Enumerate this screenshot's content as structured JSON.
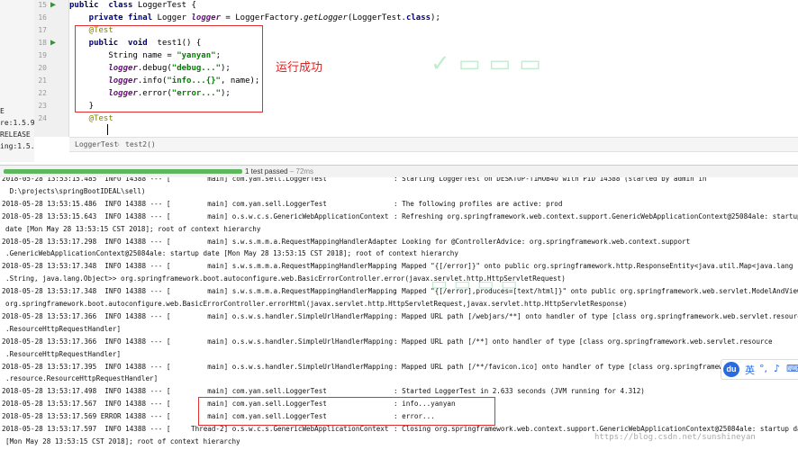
{
  "left_strip": [
    "E",
    "re:1.5.9.RE",
    "RELEASE",
    "ing:1.5.9.R"
  ],
  "editor": {
    "line_numbers": [
      "15",
      "16",
      "17",
      "18",
      "19",
      "20",
      "21",
      "22",
      "23",
      "24"
    ],
    "lines": [
      {
        "n": "15",
        "parts": [
          [
            "kw",
            "public  class "
          ],
          [
            "cls",
            "LoggerTest {"
          ]
        ]
      },
      {
        "n": "16",
        "parts": [
          [
            "kw",
            "    private final "
          ],
          [
            "cls",
            "Logger "
          ],
          [
            "fld",
            "logger"
          ],
          [
            "cls",
            " = LoggerFactory."
          ],
          [
            "it",
            "getLogger"
          ],
          [
            "cls",
            "(LoggerTest."
          ],
          [
            "kw",
            "class"
          ],
          [
            "cls",
            ");"
          ]
        ]
      },
      {
        "n": "17",
        "parts": [
          [
            "ann",
            "    @Test"
          ]
        ]
      },
      {
        "n": "18",
        "parts": [
          [
            "kw",
            "    public  void "
          ],
          [
            "cls",
            " test1() {"
          ]
        ]
      },
      {
        "n": "19",
        "parts": [
          [
            "cls",
            "        String name = "
          ],
          [
            "str",
            "\"yanyan\""
          ],
          [
            "cls",
            ";"
          ]
        ]
      },
      {
        "n": "20",
        "parts": [
          [
            "fld",
            "        logger"
          ],
          [
            "cls",
            ".debug("
          ],
          [
            "str",
            "\"debug...\""
          ],
          [
            "cls",
            ");"
          ]
        ]
      },
      {
        "n": "21",
        "parts": [
          [
            "fld",
            "        logger"
          ],
          [
            "cls",
            ".info("
          ],
          [
            "str",
            "\"info...{}\""
          ],
          [
            "cls",
            ", name);"
          ]
        ]
      },
      {
        "n": "22",
        "parts": [
          [
            "fld",
            "        logger"
          ],
          [
            "cls",
            ".error("
          ],
          [
            "str",
            "\"error...\""
          ],
          [
            "cls",
            ");"
          ]
        ]
      },
      {
        "n": "23",
        "parts": [
          [
            "cls",
            "    }"
          ]
        ]
      },
      {
        "n": "24",
        "parts": [
          [
            "ann",
            "    @Test"
          ]
        ]
      }
    ],
    "annotation_text": "运行成功"
  },
  "breadcrumb": {
    "class_name": "LoggerTest",
    "method": "test2()"
  },
  "test_status": {
    "passed": "1 test passed",
    "duration": " – 72ms"
  },
  "console": [
    {
      "p": "2018-05-28 13:53:15.485  INFO 14388 --- [",
      "m": "           main] com.yan.sell.LoggerTest",
      "r": ": Starting LoggerTest on DESKTOP-T1MOB4O with PID 14388 (started by admin in"
    },
    {
      "c": " D:\\projects\\springBootIDEAL\\sell)"
    },
    {
      "p": "2018-05-28 13:53:15.486  INFO 14388 --- [",
      "m": "           main] com.yan.sell.LoggerTest",
      "r": ": The following profiles are active: prod"
    },
    {
      "p": "2018-05-28 13:53:15.643  INFO 14388 --- [",
      "m": "           main] o.s.w.c.s.GenericWebApplicationContext",
      "r": ": Refreshing org.springframework.web.context.support.GenericWebApplicationContext@25084ale: startup"
    },
    {
      "c": "date [Mon May 28 13:53:15 CST 2018]; root of context hierarchy"
    },
    {
      "p": "2018-05-28 13:53:17.298  INFO 14388 --- [",
      "m": "           main] s.w.s.m.m.a.RequestMappingHandlerAdapter",
      "r": ": Looking for @ControllerAdvice: org.springframework.web.context.support"
    },
    {
      "c": ".GenericWebApplicationContext@25084ale: startup date [Mon May 28 13:53:15 CST 2018]; root of context hierarchy"
    },
    {
      "p": "2018-05-28 13:53:17.348  INFO 14388 --- [",
      "m": "           main] s.w.s.m.m.a.RequestMappingHandlerMapping",
      "r": ": Mapped \"{[/error]}\" onto public org.springframework.http.ResponseEntity<java.util.Map<java.lang"
    },
    {
      "c": ".String, java.lang.Object>> org.springframework.boot.autoconfigure.web.BasicErrorController.error(javax.servlet.http.HttpServletRequest)"
    },
    {
      "p": "2018-05-28 13:53:17.348  INFO 14388 --- [",
      "m": "           main] s.w.s.m.m.a.RequestMappingHandlerMapping",
      "r": ": Mapped \"{[/error],produces=[text/html]}\" onto public org.springframework.web.servlet.ModelAndView"
    },
    {
      "c": "org.springframework.boot.autoconfigure.web.BasicErrorController.errorHtml(javax.servlet.http.HttpServletRequest,javax.servlet.http.HttpServletResponse)"
    },
    {
      "p": "2018-05-28 13:53:17.366  INFO 14388 --- [",
      "m": "           main] o.s.w.s.handler.SimpleUrlHandlerMapping",
      "r": ": Mapped URL path [/webjars/**] onto handler of type [class org.springframework.web.servlet.resource"
    },
    {
      "c": ".ResourceHttpRequestHandler]"
    },
    {
      "p": "2018-05-28 13:53:17.366  INFO 14388 --- [",
      "m": "           main] o.s.w.s.handler.SimpleUrlHandlerMapping",
      "r": ": Mapped URL path [/**] onto handler of type [class org.springframework.web.servlet.resource"
    },
    {
      "c": ".ResourceHttpRequestHandler]"
    },
    {
      "p": "2018-05-28 13:53:17.395  INFO 14388 --- [",
      "m": "           main] o.s.w.s.handler.SimpleUrlHandlerMapping",
      "r": ": Mapped URL path [/**/favicon.ico] onto handler of type [class org.springframewor"
    },
    {
      "c": ".resource.ResourceHttpRequestHandler]"
    },
    {
      "p": "2018-05-28 13:53:17.498  INFO 14388 --- [",
      "m": "           main] com.yan.sell.LoggerTest",
      "r": ": Started LoggerTest in 2.633 seconds (JVM running for 4.312)"
    },
    {
      "p": "2018-05-28 13:53:17.567  INFO 14388 --- [",
      "m": "           main] com.yan.sell.LoggerTest",
      "r": ": info...yanyan"
    },
    {
      "p": "2018-05-28 13:53:17.569 ERROR 14388 --- [",
      "m": "           main] com.yan.sell.LoggerTest",
      "r": ": error..."
    },
    {
      "p": "2018-05-28 13:53:17.597  INFO 14388 --- [",
      "m": "       Thread-2] o.s.w.c.s.GenericWebApplicationContext",
      "r": ": Closing org.springframework.web.context.support.GenericWebApplicationContext@25084ale: startup date"
    },
    {
      "c": "[Mon May 28 13:53:15 CST 2018]; root of context hierarchy"
    }
  ],
  "watermark": {
    "url": "https://blog.csdn.net/sunshineyan"
  },
  "ime_toolbar": {
    "logo": "du",
    "lang": "英"
  }
}
